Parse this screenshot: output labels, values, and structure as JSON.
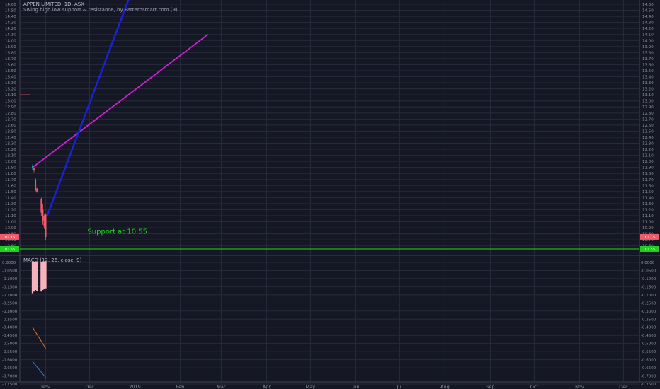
{
  "header": {
    "title": "APPEN LIMITED, 1D, ASX",
    "subtitle": "Swing high low support & resistance, by Patternsmart.com (9)"
  },
  "macd": {
    "label": "MACD (12, 26, close, 9)"
  },
  "annotation": {
    "support_text": "Support at 10.55",
    "support_color": "#22d622"
  },
  "colors": {
    "background": "#151824",
    "grid": "#262a3a",
    "text": "#b8bccb",
    "resistance_line": "#d41ed6",
    "trend_line": "#1a22d8",
    "support_line": "#1fb51f",
    "down_candle": "#f05b6b",
    "up_candle": "#26a69a",
    "histogram": "#f7b3bd",
    "macd_line": "#2e7bd6",
    "signal_line": "#e0752a"
  },
  "chart_data": [
    {
      "type": "line",
      "title": "APPEN LIMITED, 1D, ASX",
      "xlabel": "",
      "ylabel": "",
      "x_ticks": [
        "Nov",
        "Dec",
        "2019",
        "Feb",
        "Mar",
        "Apr",
        "May",
        "Jun",
        "Jul",
        "Aug",
        "Sep",
        "Oct",
        "Nov",
        "Dec"
      ],
      "ylim": [
        10.55,
        14.65
      ],
      "y_ticks": [
        "14.60",
        "14.50",
        "14.40",
        "14.30",
        "14.20",
        "14.10",
        "14.00",
        "13.90",
        "13.80",
        "13.70",
        "13.60",
        "13.50",
        "13.40",
        "13.30",
        "13.20",
        "13.10",
        "13.00",
        "12.90",
        "12.80",
        "12.70",
        "12.60",
        "12.50",
        "12.40",
        "12.30",
        "12.20",
        "12.10",
        "12.00",
        "11.90",
        "11.80",
        "11.70",
        "11.60",
        "11.50",
        "11.40",
        "11.30",
        "11.20",
        "11.10",
        "11.00",
        "10.90",
        "10.80",
        "10.70",
        "10.60"
      ],
      "price_labels": [
        {
          "text": "10.75",
          "value": 10.75,
          "color": "#f05b6b"
        },
        {
          "text": "10.55",
          "value": 10.55,
          "color": "#1fd01f"
        }
      ],
      "grid": true,
      "candles": [
        {
          "x": "2018-10-23",
          "open": 11.9,
          "high": 11.95,
          "low": 11.86,
          "close": 11.92
        },
        {
          "x": "2018-10-24",
          "open": 11.88,
          "high": 11.9,
          "low": 11.82,
          "close": 11.85
        },
        {
          "x": "2018-10-25",
          "open": 11.7,
          "high": 11.72,
          "low": 11.5,
          "close": 11.52
        },
        {
          "x": "2018-10-26",
          "open": 11.55,
          "high": 11.56,
          "low": 11.48,
          "close": 11.5
        },
        {
          "x": "2018-10-29",
          "open": 11.38,
          "high": 11.4,
          "low": 11.1,
          "close": 11.15
        },
        {
          "x": "2018-10-30",
          "open": 11.2,
          "high": 11.3,
          "low": 10.95,
          "close": 11.02
        },
        {
          "x": "2018-10-31",
          "open": 11.1,
          "high": 11.12,
          "low": 10.88,
          "close": 10.92
        },
        {
          "x": "2018-11-01",
          "open": 11.12,
          "high": 11.14,
          "low": 10.7,
          "close": 10.75
        }
      ],
      "lines": [
        {
          "name": "",
          "from": {
            "x": "2018-10-23",
            "y": 11.9
          },
          "to": {
            "x": "2019-02-20",
            "y": 14.1
          }
        },
        {
          "name": "",
          "from": {
            "x": "2018-11-02",
            "y": 11.1
          },
          "to": {
            "x": "2018-12-28",
            "y": 14.7
          }
        },
        {
          "name": "",
          "horizontal": true,
          "y": 10.55
        }
      ],
      "annotations": [
        {
          "text": "Support at 10.55",
          "x": "2018-12-20",
          "y": 10.85
        }
      ]
    },
    {
      "type": "bar",
      "title": "MACD (12, 26, close, 9)",
      "ylim": [
        -0.75,
        0.02
      ],
      "y_ticks": [
        "0.0000",
        "-0.0500",
        "-0.1000",
        "-0.1500",
        "-0.2000",
        "-0.2500",
        "-0.3000",
        "-0.3500",
        "-0.4000",
        "-0.4500",
        "-0.5000",
        "-0.5500",
        "-0.6000",
        "-0.6500",
        "-0.7000",
        "-0.7500"
      ],
      "histogram": [
        {
          "x": "2018-10-23",
          "value": -0.19
        },
        {
          "x": "2018-10-24",
          "value": -0.18
        },
        {
          "x": "2018-10-25",
          "value": -0.17
        },
        {
          "x": "2018-10-26",
          "value": -0.175
        },
        {
          "x": "2018-10-29",
          "value": -0.18
        },
        {
          "x": "2018-10-30",
          "value": -0.17
        },
        {
          "x": "2018-10-31",
          "value": -0.165
        },
        {
          "x": "2018-11-01",
          "value": -0.16
        }
      ],
      "series": [
        {
          "name": "",
          "color": "#2e7bd6",
          "points": [
            {
              "x": "2018-10-23",
              "y": -0.61
            },
            {
              "x": "2018-11-01",
              "y": -0.71
            }
          ]
        },
        {
          "name": "",
          "color": "#e0752a",
          "points": [
            {
              "x": "2018-10-23",
              "y": -0.4
            },
            {
              "x": "2018-11-01",
              "y": -0.53
            }
          ]
        }
      ]
    }
  ]
}
